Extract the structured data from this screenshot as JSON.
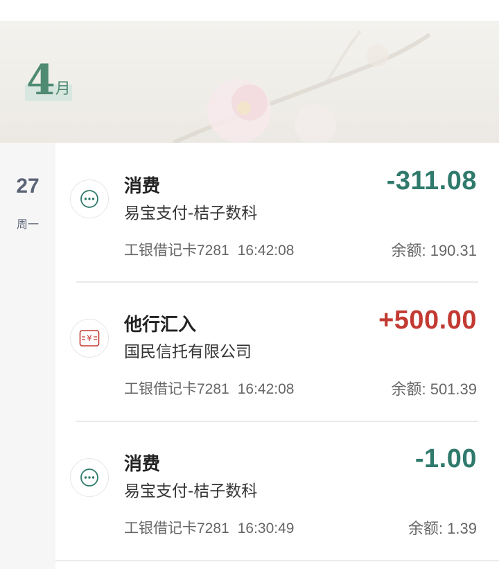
{
  "month": {
    "number": "4",
    "unit": "月"
  },
  "date": {
    "day": "27",
    "weekday": "周一"
  },
  "transactions": [
    {
      "title": "消费",
      "merchant": "易宝支付-桔子数科",
      "card": "工银借记卡7281",
      "time": "16:42:08",
      "amount": "-311.08",
      "balance": "余额: 190.31",
      "icon": "more-dots-icon",
      "type": "expense"
    },
    {
      "title": "他行汇入",
      "merchant": "国民信托有限公司",
      "card": "工银借记卡7281",
      "time": "16:42:08",
      "amount": "+500.00",
      "balance": "余额: 501.39",
      "icon": "transfer-in-icon",
      "type": "income"
    },
    {
      "title": "消费",
      "merchant": "易宝支付-桔子数科",
      "card": "工银借记卡7281",
      "time": "16:30:49",
      "amount": "-1.00",
      "balance": "余额: 1.39",
      "icon": "more-dots-icon",
      "type": "expense"
    }
  ],
  "colors": {
    "expense": "#2f7a6c",
    "income": "#c23a32",
    "month": "#4f8a72",
    "date": "#5b6377"
  }
}
